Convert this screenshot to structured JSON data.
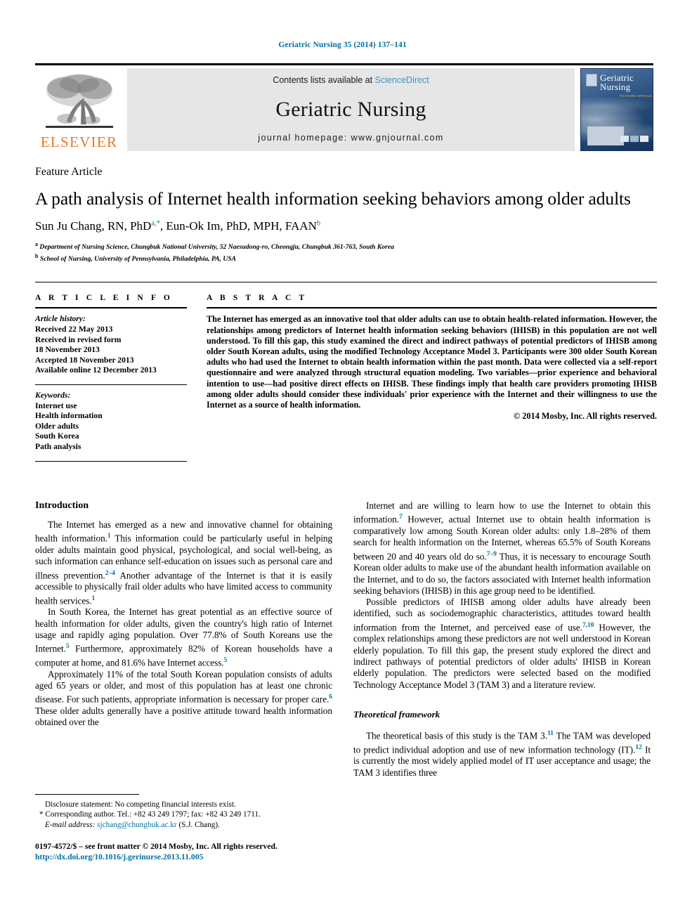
{
  "running_head": "Geriatric Nursing 35 (2014) 137–141",
  "masthead": {
    "contents_prefix": "Contents lists available at ",
    "sciencedirect": "ScienceDirect",
    "journal_name": "Geriatric Nursing",
    "homepage": "journal homepage: www.gnjournal.com",
    "publisher_wordmark": "ELSEVIER",
    "cover": {
      "title_line1": "Geriatric",
      "title_line2": "Nursing",
      "subtitle": "FEATURE ARTICLE"
    }
  },
  "article": {
    "section_label": "Feature Article",
    "title": "A path analysis of Internet health information seeking behaviors among older adults",
    "authors_part1": "Sun Ju Chang, RN, PhD",
    "authors_sup1": "a,*",
    "authors_part2": ", Eun-Ok Im, PhD, MPH, FAAN",
    "authors_sup2": "b",
    "affiliations": [
      {
        "marker": "a",
        "text": "Department of Nursing Science, Chungbuk National University, 52 Naesudong-ro, Cheongju, Chungbuk 361-763, South Korea"
      },
      {
        "marker": "b",
        "text": "School of Nursing, University of Pennsylvania, Philadelphia, PA, USA"
      }
    ]
  },
  "article_info": {
    "heading": "A R T I C L E   I N F O",
    "history_label": "Article history:",
    "history": [
      "Received 22 May 2013",
      "Received in revised form",
      "18 November 2013",
      "Accepted 18 November 2013",
      "Available online 12 December 2013"
    ],
    "keywords_label": "Keywords:",
    "keywords": [
      "Internet use",
      "Health information",
      "Older adults",
      "South Korea",
      "Path analysis"
    ]
  },
  "abstract": {
    "heading": "A B S T R A C T",
    "text": "The Internet has emerged as an innovative tool that older adults can use to obtain health-related information. However, the relationships among predictors of Internet health information seeking behaviors (IHISB) in this population are not well understood. To fill this gap, this study examined the direct and indirect pathways of potential predictors of IHISB among older South Korean adults, using the modified Technology Acceptance Model 3. Participants were 300 older South Korean adults who had used the Internet to obtain health information within the past month. Data were collected via a self-report questionnaire and were analyzed through structural equation modeling. Two variables—prior experience and behavioral intention to use—had positive direct effects on IHISB. These findings imply that health care providers promoting IHISB among older adults should consider these individuals' prior experience with the Internet and their willingness to use the Internet as a source of health information.",
    "copyright": "© 2014 Mosby, Inc. All rights reserved."
  },
  "body": {
    "left": {
      "heading": "Introduction",
      "paragraphs": [
        {
          "runs": [
            {
              "t": "The Internet has emerged as a new and innovative channel for obtaining health information."
            },
            {
              "t": "1",
              "ref": true
            },
            {
              "t": " This information could be particularly useful in helping older adults maintain good physical, psychological, and social well-being, as such information can enhance self-education on issues such as personal care and illness prevention."
            },
            {
              "t": "2–4",
              "ref": true
            },
            {
              "t": " Another advantage of the Internet is that it is easily accessible to physically frail older adults who have limited access to community health services."
            },
            {
              "t": "1",
              "ref": true
            }
          ]
        },
        {
          "runs": [
            {
              "t": "In South Korea, the Internet has great potential as an effective source of health information for older adults, given the country's high ratio of Internet usage and rapidly aging population. Over 77.8% of South Koreans use the Internet."
            },
            {
              "t": "5",
              "ref": true
            },
            {
              "t": " Furthermore, approximately 82% of Korean households have a computer at home, and 81.6% have Internet access."
            },
            {
              "t": "5",
              "ref": true
            }
          ]
        },
        {
          "runs": [
            {
              "t": "Approximately 11% of the total South Korean population consists of adults aged 65 years or older, and most of this population has at least one chronic disease. For such patients, appropriate information is necessary for proper care."
            },
            {
              "t": "6",
              "ref": true
            },
            {
              "t": " These older adults generally have a positive attitude toward health information obtained over the"
            }
          ]
        }
      ]
    },
    "right": {
      "paragraphs": [
        {
          "runs": [
            {
              "t": "Internet and are willing to learn how to use the Internet to obtain this information."
            },
            {
              "t": "7",
              "ref": true
            },
            {
              "t": " However, actual Internet use to obtain health information is comparatively low among South Korean older adults: only 1.8–28% of them search for health information on the Internet, whereas 65.5% of South Koreans between 20 and 40 years old do so."
            },
            {
              "t": "7–9",
              "ref": true
            },
            {
              "t": " Thus, it is necessary to encourage South Korean older adults to make use of the abundant health information available on the Internet, and to do so, the factors associated with Internet health information seeking behaviors (IHISB) in this age group need to be identified."
            }
          ]
        },
        {
          "runs": [
            {
              "t": "Possible predictors of IHISB among older adults have already been identified, such as sociodemographic characteristics, attitudes toward health information from the Internet, and perceived ease of use."
            },
            {
              "t": "7,10",
              "ref": true
            },
            {
              "t": " However, the complex relationships among these predictors are not well understood in Korean elderly population. To fill this gap, the present study explored the direct and indirect pathways of potential predictors of older adults' IHISB in Korean elderly population. The predictors were selected based on the modified Technology Acceptance Model 3 (TAM 3) and a literature review."
            }
          ]
        }
      ],
      "subheading": "Theoretical framework",
      "paragraphs2": [
        {
          "runs": [
            {
              "t": "The theoretical basis of this study is the TAM 3."
            },
            {
              "t": "11",
              "ref": true
            },
            {
              "t": " The TAM was developed to predict individual adoption and use of new information technology (IT)."
            },
            {
              "t": "12",
              "ref": true
            },
            {
              "t": " It is currently the most widely applied model of IT user acceptance and usage; the TAM 3 identifies three"
            }
          ]
        }
      ]
    }
  },
  "footnotes": {
    "disclosure": "Disclosure statement: No competing financial interests exist.",
    "corresponding": "* Corresponding author. Tel.: +82 43 249 1797; fax: +82 43 249 1711.",
    "email_label": "E-mail address:",
    "email": "sjchang@chungbuk.ac.kr",
    "email_suffix": "(S.J. Chang)."
  },
  "page_footer": {
    "issn_line": "0197-4572/$ – see front matter © 2014 Mosby, Inc. All rights reserved.",
    "doi": "http://dx.doi.org/10.1016/j.gerinurse.2013.11.005"
  },
  "colors": {
    "link_blue": "#00709e",
    "sciencedirect_blue": "#3b93c7",
    "elsevier_orange": "#e87722",
    "band_gray": "#e6e6e6"
  }
}
